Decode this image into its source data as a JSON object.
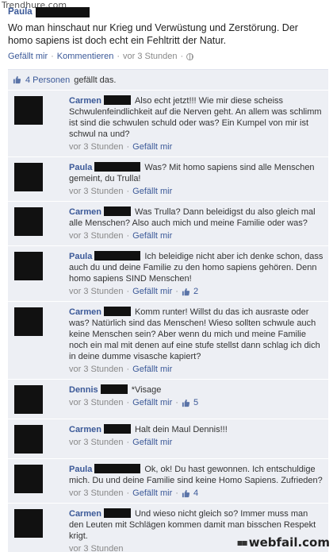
{
  "watermark_top": "Trendhure.com",
  "watermark_bottom": "webfail.com",
  "post": {
    "author": "Paula",
    "text": "Wo man hinschaut nur Krieg und Verwüstung und Zerstörung. Der homo sapiens ist doch echt ein Fehltritt der Natur.",
    "like_label": "Gefällt mir",
    "comment_label": "Kommentieren",
    "time": "vor 3 Stunden",
    "separator": "·"
  },
  "likes": {
    "text": "4 Personen",
    "suffix": "gefällt das."
  },
  "comments": [
    {
      "author": "Carmen",
      "censor_w": 34,
      "text": "Also echt jetzt!!! Wie mir diese scheiss Schwulenfeindlichkeit auf die Nerven geht. An allem was schlimm ist sind die schwulen schuld oder was? Ein Kumpel von mir ist schwul na und?",
      "time": "vor 3 Stunden",
      "like_label": "Gefällt mir",
      "likes": ""
    },
    {
      "author": "Paula",
      "censor_w": 58,
      "text": "Was? Mit homo sapiens sind alle Menschen gemeint, du Trulla!",
      "time": "vor 3 Stunden",
      "like_label": "Gefällt mir",
      "likes": ""
    },
    {
      "author": "Carmen",
      "censor_w": 34,
      "text": "Was Trulla? Dann beleidigst du also gleich mal alle Menschen? Also auch mich und meine Familie oder was?",
      "time": "vor 3 Stunden",
      "like_label": "Gefällt mir",
      "likes": ""
    },
    {
      "author": "Paula",
      "censor_w": 58,
      "text": "Ich beleidige nicht aber ich denke schon, dass auch du und deine Familie zu den homo sapiens gehören. Denn homo sapiens SIND Menschen!",
      "time": "vor 3 Stunden",
      "like_label": "Gefällt mir",
      "likes": "2"
    },
    {
      "author": "Carmen",
      "censor_w": 34,
      "text": "Komm runter! Willst du das ich ausraste oder was? Natürlich sind das Menschen! Wieso sollten schwule auch keine Menschen sein? Aber wenn du mich und meine Familie noch ein mal mit denen auf eine stufe stellst dann schlag ich dich in deine dumme visasche kapiert?",
      "time": "vor 3 Stunden",
      "like_label": "Gefällt mir",
      "likes": ""
    },
    {
      "author": "Dennis",
      "censor_w": 34,
      "text": "*Visage",
      "time": "vor 3 Stunden",
      "like_label": "Gefällt mir",
      "likes": "5"
    },
    {
      "author": "Carmen",
      "censor_w": 34,
      "text": "Halt dein Maul Dennis!!!",
      "time": "vor 3 Stunden",
      "like_label": "Gefällt mir",
      "likes": ""
    },
    {
      "author": "Paula",
      "censor_w": 58,
      "text": "Ok, ok! Du hast gewonnen. Ich entschuldige mich. Du und deine Familie sind keine Homo Sapiens. Zufrieden?",
      "time": "vor 3 Stunden",
      "like_label": "Gefällt mir",
      "likes": "4"
    },
    {
      "author": "Carmen",
      "censor_w": 34,
      "text": "Und wieso nicht gleich so? Immer muss man den Leuten mit Schlägen kommen damit man bisschen Respekt krigt.",
      "time": "vor 3 Stunden",
      "like_label": "",
      "likes": ""
    }
  ]
}
